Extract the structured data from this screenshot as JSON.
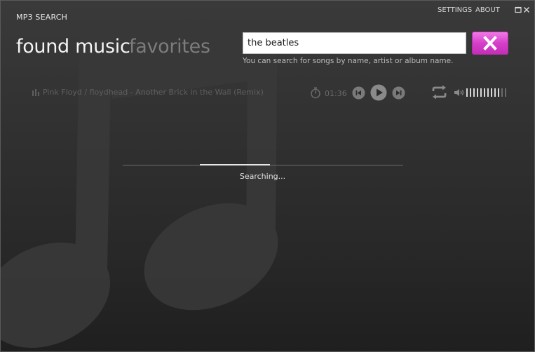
{
  "app": {
    "title": "MP3 SEARCH"
  },
  "titlebar": {
    "settings_label": "SETTINGS",
    "about_label": "ABOUT",
    "maximize_icon": "maximize-icon",
    "close_icon": "close-icon"
  },
  "tabs": [
    {
      "label": "found music",
      "active": true
    },
    {
      "label": "favorites",
      "active": false
    }
  ],
  "search": {
    "value": "the beatles",
    "hint": "You can search for songs by name, artist or album name.",
    "clear_icon": "x-icon",
    "clear_button_color": "#d63fc9"
  },
  "player": {
    "now_playing": "Pink Floyd / floydhead - Another Brick in the Wall (Remix)",
    "elapsed": "01:36",
    "volume_level": 0.8
  },
  "status": {
    "text": "Searching..."
  },
  "colors": {
    "accent": "#d63fc9",
    "background": "#2c2c2c",
    "text": "#e8e8e8",
    "muted": "#6a6a6a"
  }
}
